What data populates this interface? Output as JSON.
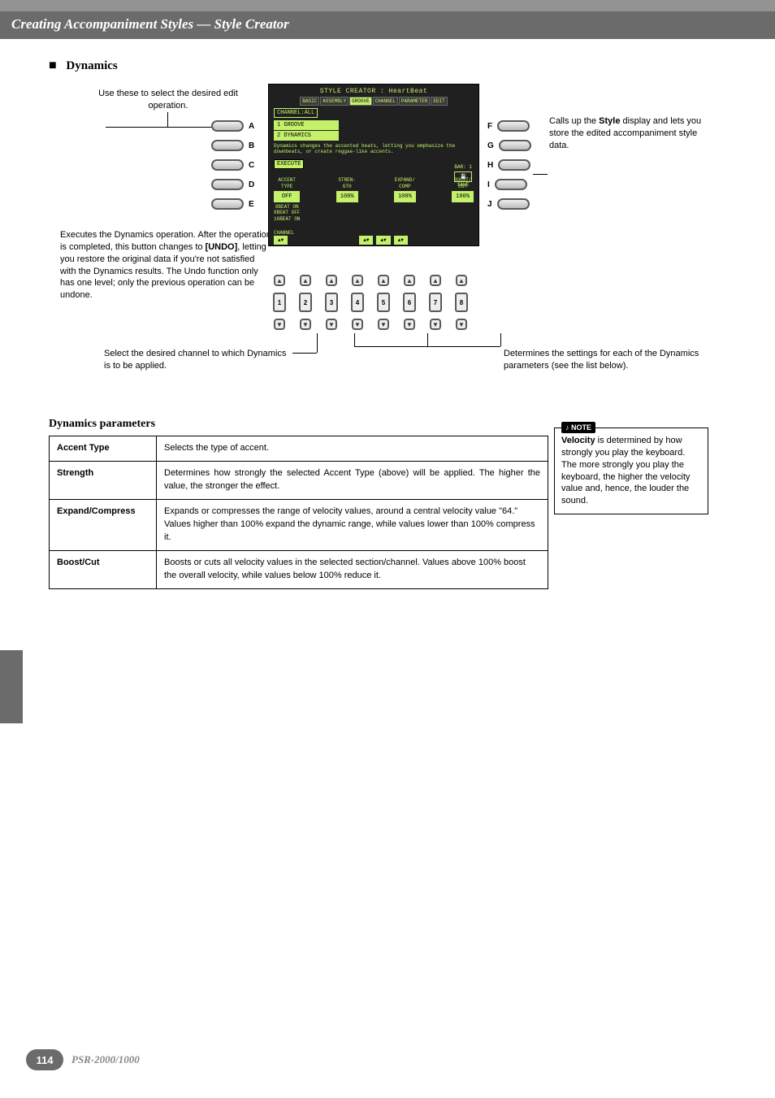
{
  "header": {
    "title": "Creating Accompaniment Styles — Style Creator"
  },
  "section": {
    "bullet": "■",
    "heading": "Dynamics"
  },
  "callouts": {
    "top_left": "Use these to select the desired edit operation.",
    "top_right_1": "Calls up the ",
    "top_right_bold": "Style",
    "top_right_2": " display and lets you store the edited accompaniment style data.",
    "bottom_left_1": "Executes the Dynamics operation. After the operation is completed, this button changes to ",
    "bottom_left_bold": "[UNDO]",
    "bottom_left_2": ", letting you restore the original data if you're not satisfied with the Dynamics results. The Undo function only has one level; only the previous operation can be undone.",
    "bottom_center": "Select the desired channel to which Dynamics is to be applied.",
    "bottom_right": "Determines the settings for each of the Dynamics parameters (see the list below)."
  },
  "buttons": {
    "left_labels": [
      "A",
      "B",
      "C",
      "D",
      "E"
    ],
    "right_labels": [
      "F",
      "G",
      "H",
      "I",
      "J"
    ],
    "sliders": [
      "1",
      "2",
      "3",
      "4",
      "5",
      "6",
      "7",
      "8"
    ]
  },
  "lcd": {
    "title": "STYLE CREATOR : HeartBeat",
    "tabs": [
      "BASIC",
      "ASSEMBLY",
      "GROOVE",
      "CHANNEL",
      "PARAMETER",
      "EDIT"
    ],
    "active_tab": 2,
    "channel_label": "CHANNEL:ALL",
    "list": {
      "row1_num": "1",
      "row1": "GROOVE",
      "row2_num": "2",
      "row2": "DYNAMICS"
    },
    "description": "Dynamics changes the accented beats, letting you emphasize the downbeats, or create reggae-like accents.",
    "execute": "EXECUTE",
    "bar_label": "BAR:",
    "bar_value": "1",
    "save": "SAVE",
    "param_headers": {
      "accent": "ACCENT\nTYPE",
      "strength": "STREN-\nGTH",
      "expand": "EXPAND/\nCOMP",
      "boost": "BOOST/\nCUT"
    },
    "param_vals": {
      "accent_off": "OFF",
      "accent_list": "8BEAT ON\n8BEAT OFF\n16BEAT ON",
      "strength": "100%",
      "expand": "100%",
      "boost": "100%"
    },
    "ch_label": "CHANNEL",
    "arrows": "▲▼"
  },
  "params": {
    "title": "Dynamics parameters",
    "rows": [
      {
        "name": "Accent Type",
        "desc": "Selects the type of accent."
      },
      {
        "name": "Strength",
        "desc": "Determines how strongly the selected Accent Type (above) will be applied. The higher the value, the stronger the effect."
      },
      {
        "name": "Expand/Compress",
        "desc": "Expands or compresses the range of velocity values, around a central velocity value \"64.\" Values higher than 100% expand the dynamic range, while values lower than 100% compress it."
      },
      {
        "name": "Boost/Cut",
        "desc": "Boosts or cuts all velocity values in the selected section/channel. Values above 100% boost the overall velocity, while values below 100% reduce it."
      }
    ]
  },
  "note": {
    "label": "NOTE",
    "text_bold": "Velocity",
    "text": " is determined by how strongly you play the keyboard.\nThe more strongly you play the keyboard, the higher the velocity value and, hence, the louder the sound."
  },
  "footer": {
    "page": "114",
    "model": "PSR-2000/1000"
  }
}
